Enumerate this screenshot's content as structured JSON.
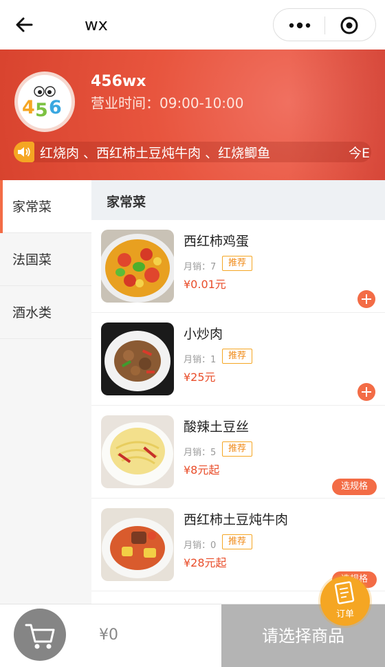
{
  "nav": {
    "title": "wx"
  },
  "shop": {
    "name": "456wx",
    "hours": "营业时间：09:00-10:00",
    "logo_text": "456",
    "notice": "红烧肉 、西红柿土豆炖牛肉 、红烧鲫鱼",
    "notice_tail": "今E"
  },
  "categories": [
    {
      "label": "家常菜",
      "active": true
    },
    {
      "label": "法国菜",
      "active": false
    },
    {
      "label": "酒水类",
      "active": false
    }
  ],
  "section_title": "家常菜",
  "items": [
    {
      "name": "西红柿鸡蛋",
      "sales": "月销：7",
      "tag": "推荐",
      "price": "¥0.01元",
      "action": "add",
      "icon": "tomato-egg-dish"
    },
    {
      "name": "小炒肉",
      "sales": "月销：1",
      "tag": "推荐",
      "price": "¥25元",
      "action": "add",
      "icon": "stir-fried-pork-dish"
    },
    {
      "name": "酸辣土豆丝",
      "sales": "月销：5",
      "tag": "推荐",
      "price": "¥8元起",
      "action": "spec",
      "action_label": "选规格",
      "icon": "potato-shreds-dish"
    },
    {
      "name": "西红柿土豆炖牛肉",
      "sales": "月销：0",
      "tag": "推荐",
      "price": "¥28元起",
      "action": "spec",
      "action_label": "选规格",
      "icon": "beef-stew-dish"
    }
  ],
  "order_fab": {
    "label": "订单"
  },
  "cart": {
    "total": "¥0",
    "checkout_label": "请选择商品"
  },
  "colors": {
    "accent": "#f36c46",
    "header": "#e8553e",
    "tag": "#f5a623",
    "price": "#e94d2a",
    "disabled": "#b4b4b4"
  }
}
